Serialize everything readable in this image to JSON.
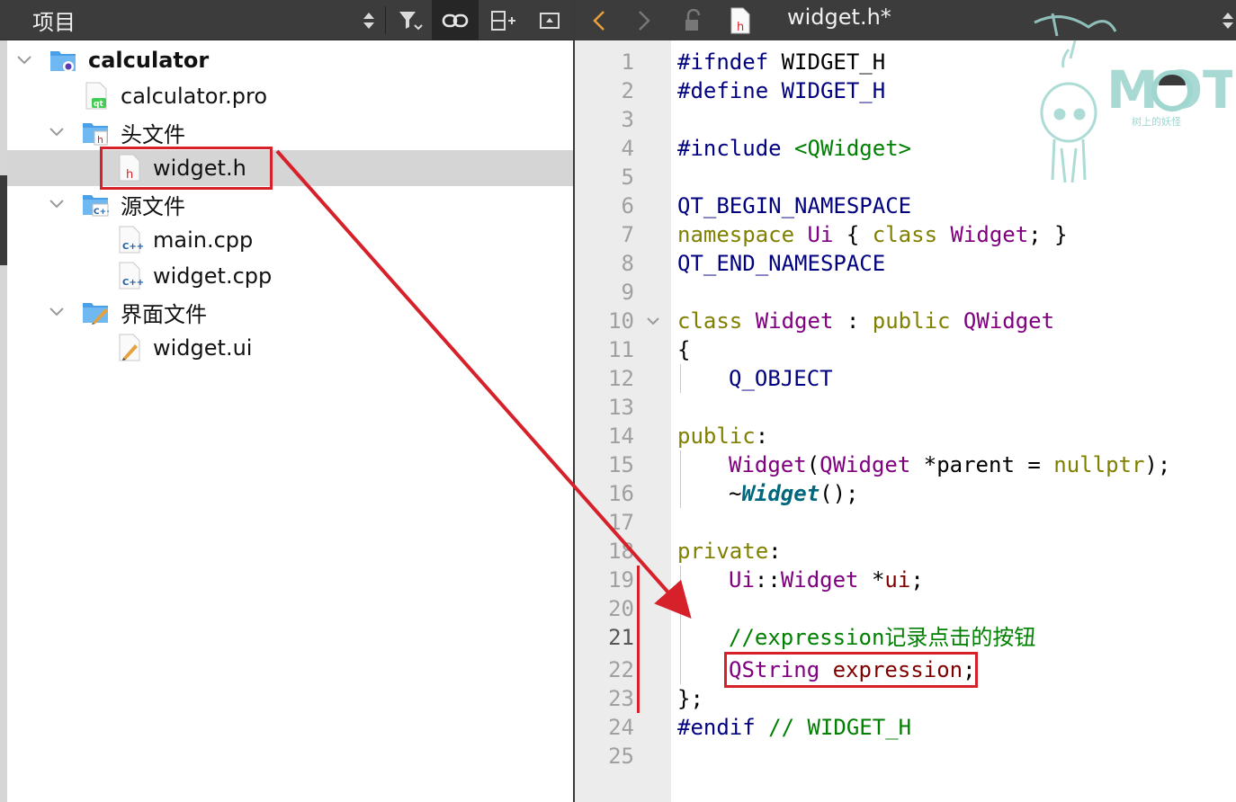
{
  "project_panel": {
    "title": "项目",
    "tree": [
      {
        "label": "calculator",
        "icon": "project-folder-icon",
        "expanded": true
      },
      {
        "label": "calculator.pro",
        "icon": "qt-pro-file-icon"
      },
      {
        "label": "头文件",
        "icon": "header-folder-icon",
        "expanded": true
      },
      {
        "label": "widget.h",
        "icon": "header-file-icon",
        "selected": true
      },
      {
        "label": "源文件",
        "icon": "source-folder-icon",
        "expanded": true
      },
      {
        "label": "main.cpp",
        "icon": "cpp-file-icon"
      },
      {
        "label": "widget.cpp",
        "icon": "cpp-file-icon"
      },
      {
        "label": "界面文件",
        "icon": "forms-folder-icon",
        "expanded": true
      },
      {
        "label": "widget.ui",
        "icon": "ui-file-icon"
      }
    ]
  },
  "editor": {
    "file_title": "widget.h*",
    "current_line": 21,
    "line_numbers": [
      "1",
      "2",
      "3",
      "4",
      "5",
      "6",
      "7",
      "8",
      "9",
      "10",
      "11",
      "12",
      "13",
      "14",
      "15",
      "16",
      "17",
      "18",
      "19",
      "20",
      "21",
      "22",
      "23",
      "24",
      "25"
    ],
    "code": {
      "l1a": "#ifndef",
      "l1b": " WIDGET_H",
      "l2a": "#define",
      "l2b": " WIDGET_H",
      "l4a": "#include",
      "l4b": " <QWidget>",
      "l6": "QT_BEGIN_NAMESPACE",
      "l7a": "namespace",
      "l7b": " Ui",
      "l7c": " { ",
      "l7d": "class",
      "l7e": " Widget",
      "l7f": "; }",
      "l8": "QT_END_NAMESPACE",
      "l10a": "class",
      "l10b": " Widget",
      "l10c": " : ",
      "l10d": "public",
      "l10e": " QWidget",
      "l11": "{",
      "l12": "Q_OBJECT",
      "l14a": "public",
      "l14b": ":",
      "l15a": "Widget",
      "l15b": "(",
      "l15c": "QWidget",
      "l15d": " *parent = ",
      "l15e": "nullptr",
      "l15f": ");",
      "l16a": "~",
      "l16b": "Widget",
      "l16c": "();",
      "l18a": "private",
      "l18b": ":",
      "l19a": "Ui",
      "l19b": "::",
      "l19c": "Widget",
      "l19d": " *",
      "l19e": "ui",
      "l19f": ";",
      "l21": "//expression记录点击的按钮",
      "l22a": "QString",
      "l22b": " expression",
      "l22c": ";",
      "l23": "};",
      "l24a": "#endif",
      "l24b": " // WIDGET_H"
    }
  },
  "watermark": {
    "text": "MOT",
    "subtext": "树上的妖怪"
  },
  "colors": {
    "highlight": "#d6202a",
    "toolbar": "#3c3c3c",
    "gutter": "#ececec",
    "selected_row": "#d5d5d5"
  }
}
